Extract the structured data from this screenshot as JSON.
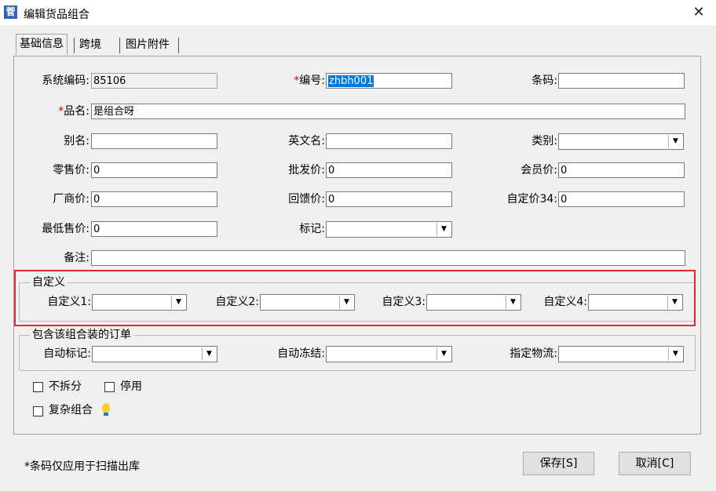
{
  "window": {
    "title": "编辑货品组合",
    "close_symbol": "✕",
    "app_icon_glyph": "菅"
  },
  "tabs": [
    {
      "label": "基础信息"
    },
    {
      "label": "跨境"
    },
    {
      "label": "图片附件"
    }
  ],
  "fields": {
    "system_code": {
      "label": "系统编码:",
      "value": "85106"
    },
    "code": {
      "required_mark": "*",
      "label": "编号:",
      "value": "zhbh001"
    },
    "barcode": {
      "label": "条码:",
      "value": ""
    },
    "product_name": {
      "required_mark": "*",
      "label": "品名:",
      "value": "是组合呀"
    },
    "alias": {
      "label": "别名:",
      "value": ""
    },
    "english_name": {
      "label": "英文名:",
      "value": ""
    },
    "category": {
      "label": "类别:",
      "value": ""
    },
    "retail_price": {
      "label": "零售价:",
      "value": "0"
    },
    "wholesale_price": {
      "label": "批发价:",
      "value": "0"
    },
    "member_price": {
      "label": "会员价:",
      "value": "0"
    },
    "factory_price": {
      "label": "厂商价:",
      "value": "0"
    },
    "return_price": {
      "label": "回馈价:",
      "value": "0"
    },
    "custom_price34": {
      "label": "自定价34:",
      "value": "0"
    },
    "min_price": {
      "label": "最低售价:",
      "value": "0"
    },
    "mark": {
      "label": "标记:",
      "value": ""
    },
    "remark": {
      "label": "备注:",
      "value": ""
    }
  },
  "custom_group": {
    "title": "自定义",
    "items": [
      {
        "label": "自定义1:",
        "value": ""
      },
      {
        "label": "自定义2:",
        "value": ""
      },
      {
        "label": "自定义3:",
        "value": ""
      },
      {
        "label": "自定义4:",
        "value": ""
      }
    ]
  },
  "order_group": {
    "title": "包含该组合装的订单",
    "items": [
      {
        "label": "自动标记:",
        "value": ""
      },
      {
        "label": "自动冻结:",
        "value": ""
      },
      {
        "label": "指定物流:",
        "value": ""
      }
    ]
  },
  "checkboxes": [
    {
      "label": "不拆分",
      "checked": false
    },
    {
      "label": "停用",
      "checked": false
    },
    {
      "label": "复杂组合",
      "checked": false
    }
  ],
  "footer": {
    "note": "*条码仅应用于扫描出库",
    "save_label": "保存[S]",
    "cancel_label": "取消[C]"
  },
  "icons": {
    "dropdown": "▼",
    "hint": "lightbulb-icon"
  },
  "colors": {
    "highlight_box": "#e0282e",
    "selection": "#0078d7",
    "required": "#d00000"
  }
}
